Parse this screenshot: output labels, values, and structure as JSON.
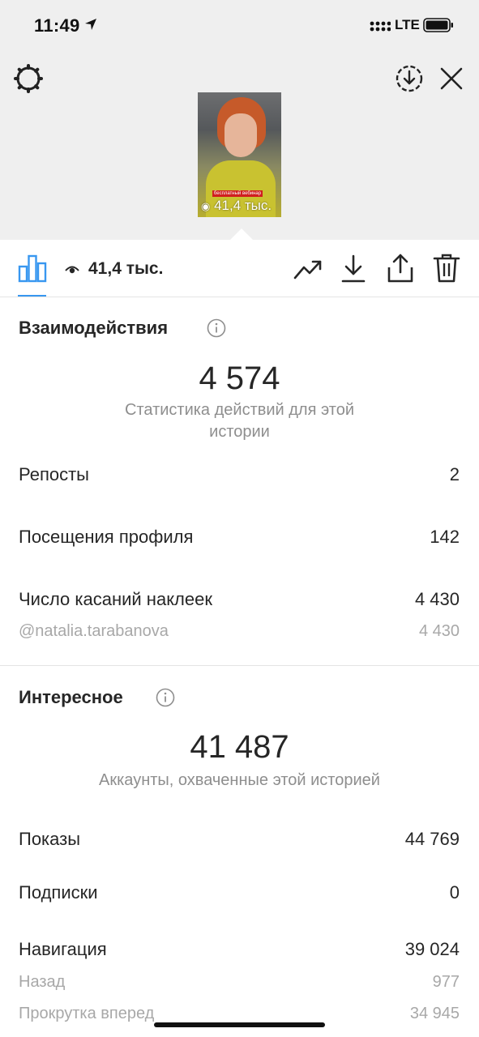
{
  "status_bar": {
    "time": "11:49",
    "network": "LTE"
  },
  "story": {
    "thumbnail_views": "41,4 тыс.",
    "thumbnail_tag": "бесплатный вебинар"
  },
  "toolbar": {
    "views": "41,4 тыс.",
    "icons": [
      "bar-chart-icon",
      "eye-icon",
      "trending-icon",
      "download-icon",
      "share-icon",
      "trash-icon"
    ]
  },
  "interactions": {
    "title": "Взаимодействия",
    "total": "4 574",
    "caption": "Статистика действий для этой истории",
    "rows": [
      {
        "label": "Репосты",
        "value": "2"
      },
      {
        "label": "Посещения профиля",
        "value": "142"
      },
      {
        "label": "Число касаний наклеек",
        "value": "4 430"
      }
    ],
    "sub_rows": [
      {
        "label": "@natalia.tarabanova",
        "value": "4 430"
      }
    ]
  },
  "discovery": {
    "title": "Интересное",
    "total": "41 487",
    "caption": "Аккаунты, охваченные этой историей",
    "rows": [
      {
        "label": "Показы",
        "value": "44 769"
      },
      {
        "label": "Подписки",
        "value": "0"
      },
      {
        "label": "Навигация",
        "value": "39 024"
      }
    ],
    "sub_rows": [
      {
        "label": "Назад",
        "value": "977"
      },
      {
        "label": "Прокрутка вперед",
        "value": "34 945"
      }
    ]
  },
  "colors": {
    "accent": "#3897f0",
    "muted": "#8e8e8e",
    "tag_red": "#d01f1f"
  }
}
